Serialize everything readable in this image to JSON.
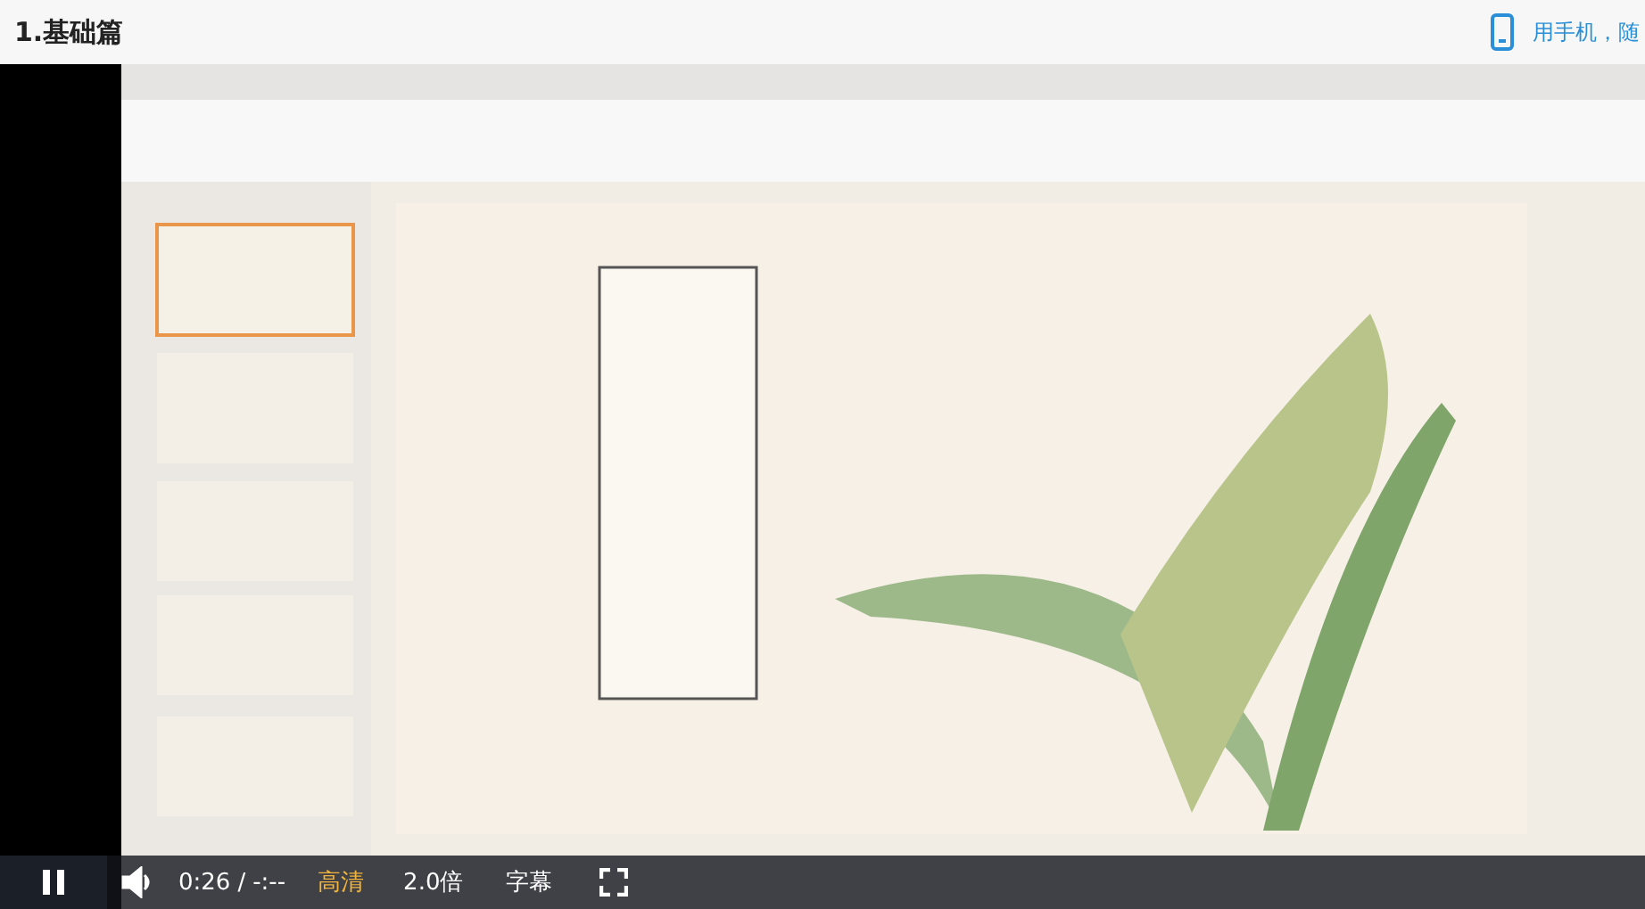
{
  "header": {
    "title": "1.基础篇",
    "mobile_link": "用手机，随"
  },
  "video": {
    "kind": "picture",
    "playing": true,
    "controls": {
      "current_time": "0:26",
      "separator": "/",
      "duration": "-:--",
      "quality": "高清",
      "speed": "2.0倍",
      "subtitles": "字幕"
    }
  }
}
